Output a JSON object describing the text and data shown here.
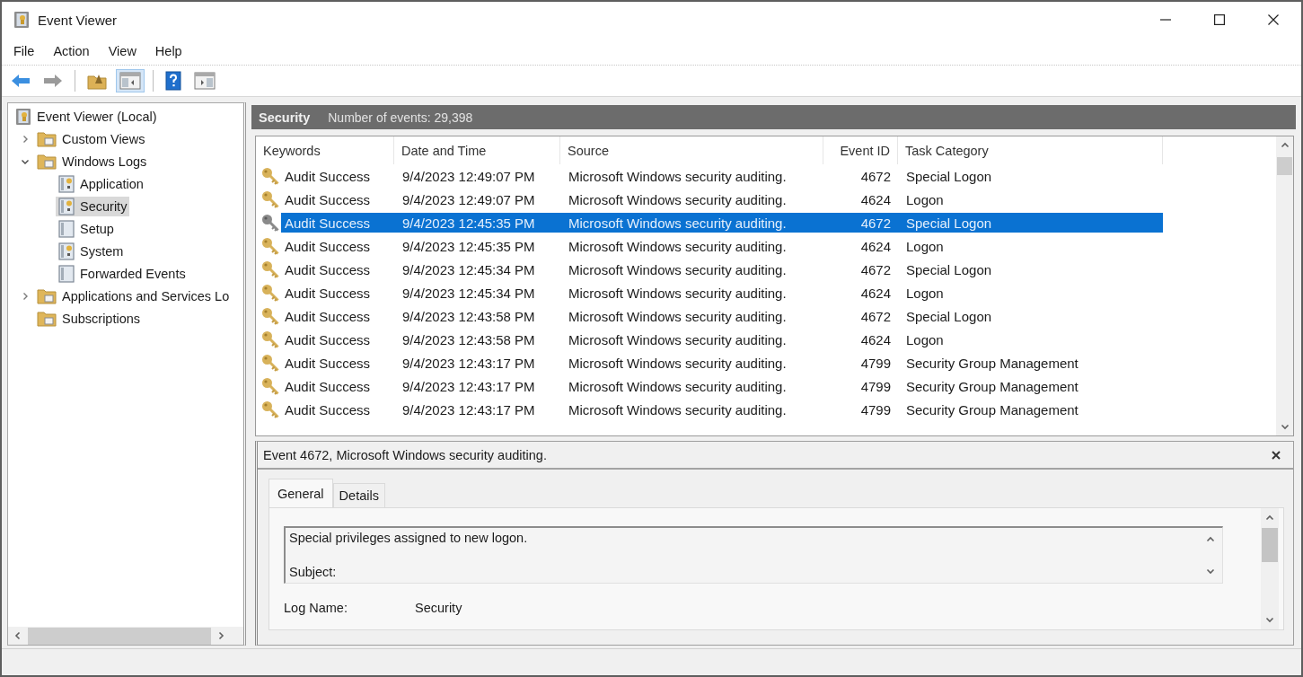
{
  "window": {
    "title": "Event Viewer"
  },
  "menu": [
    "File",
    "Action",
    "View",
    "Help"
  ],
  "toolbar": [
    [
      {
        "kind": "back",
        "disabled": false,
        "pressed": false
      },
      {
        "kind": "forward",
        "disabled": true,
        "pressed": false
      }
    ],
    [
      {
        "kind": "up",
        "disabled": false,
        "pressed": false
      },
      {
        "kind": "console-tree",
        "disabled": false,
        "pressed": true
      }
    ],
    [
      {
        "kind": "help",
        "disabled": false,
        "pressed": false
      },
      {
        "kind": "action-pane",
        "disabled": false,
        "pressed": false
      }
    ]
  ],
  "tree": [
    {
      "label": "Event Viewer (Local)",
      "kind": "root",
      "selected": false,
      "children": [
        {
          "label": "Custom Views",
          "kind": "folder",
          "expandable": true,
          "expanded": false,
          "selected": false
        },
        {
          "label": "Windows Logs",
          "kind": "folder",
          "expandable": true,
          "expanded": true,
          "selected": false,
          "children": [
            {
              "label": "Application",
              "kind": "log",
              "selected": false
            },
            {
              "label": "Security",
              "kind": "log",
              "selected": true
            },
            {
              "label": "Setup",
              "kind": "plain-log",
              "selected": false
            },
            {
              "label": "System",
              "kind": "log",
              "selected": false
            },
            {
              "label": "Forwarded Events",
              "kind": "plain-log",
              "selected": false
            }
          ]
        },
        {
          "label": "Applications and Services Lo",
          "kind": "folder",
          "expandable": true,
          "expanded": false,
          "selected": false
        },
        {
          "label": "Subscriptions",
          "kind": "folder",
          "expandable": false,
          "selected": false
        }
      ]
    }
  ],
  "log_header": {
    "title": "Security",
    "count": "Number of events: 29,398"
  },
  "events": {
    "columns": [
      "Keywords",
      "Date and Time",
      "Source",
      "Event ID",
      "Task Category"
    ],
    "rows": [
      {
        "cells": [
          "Audit Success",
          "9/4/2023 12:49:07 PM",
          "Microsoft Windows security auditing.",
          "4672",
          "Special Logon"
        ],
        "selected": false
      },
      {
        "cells": [
          "Audit Success",
          "9/4/2023 12:49:07 PM",
          "Microsoft Windows security auditing.",
          "4624",
          "Logon"
        ],
        "selected": false
      },
      {
        "cells": [
          "Audit Success",
          "9/4/2023 12:45:35 PM",
          "Microsoft Windows security auditing.",
          "4672",
          "Special Logon"
        ],
        "selected": true
      },
      {
        "cells": [
          "Audit Success",
          "9/4/2023 12:45:35 PM",
          "Microsoft Windows security auditing.",
          "4624",
          "Logon"
        ],
        "selected": false
      },
      {
        "cells": [
          "Audit Success",
          "9/4/2023 12:45:34 PM",
          "Microsoft Windows security auditing.",
          "4672",
          "Special Logon"
        ],
        "selected": false
      },
      {
        "cells": [
          "Audit Success",
          "9/4/2023 12:45:34 PM",
          "Microsoft Windows security auditing.",
          "4624",
          "Logon"
        ],
        "selected": false
      },
      {
        "cells": [
          "Audit Success",
          "9/4/2023 12:43:58 PM",
          "Microsoft Windows security auditing.",
          "4672",
          "Special Logon"
        ],
        "selected": false
      },
      {
        "cells": [
          "Audit Success",
          "9/4/2023 12:43:58 PM",
          "Microsoft Windows security auditing.",
          "4624",
          "Logon"
        ],
        "selected": false
      },
      {
        "cells": [
          "Audit Success",
          "9/4/2023 12:43:17 PM",
          "Microsoft Windows security auditing.",
          "4799",
          "Security Group Management"
        ],
        "selected": false
      },
      {
        "cells": [
          "Audit Success",
          "9/4/2023 12:43:17 PM",
          "Microsoft Windows security auditing.",
          "4799",
          "Security Group Management"
        ],
        "selected": false
      },
      {
        "cells": [
          "Audit Success",
          "9/4/2023 12:43:17 PM",
          "Microsoft Windows security auditing.",
          "4799",
          "Security Group Management"
        ],
        "selected": false
      }
    ]
  },
  "event_detail": {
    "title": "Event 4672, Microsoft Windows security auditing.",
    "tabs": [
      {
        "label": "General",
        "selected": true
      },
      {
        "label": "Details",
        "selected": false
      }
    ],
    "description": [
      "Special privileges assigned to new logon.",
      "Subject:"
    ],
    "fields": [
      {
        "label": "Log Name:",
        "value": "Security"
      }
    ]
  }
}
